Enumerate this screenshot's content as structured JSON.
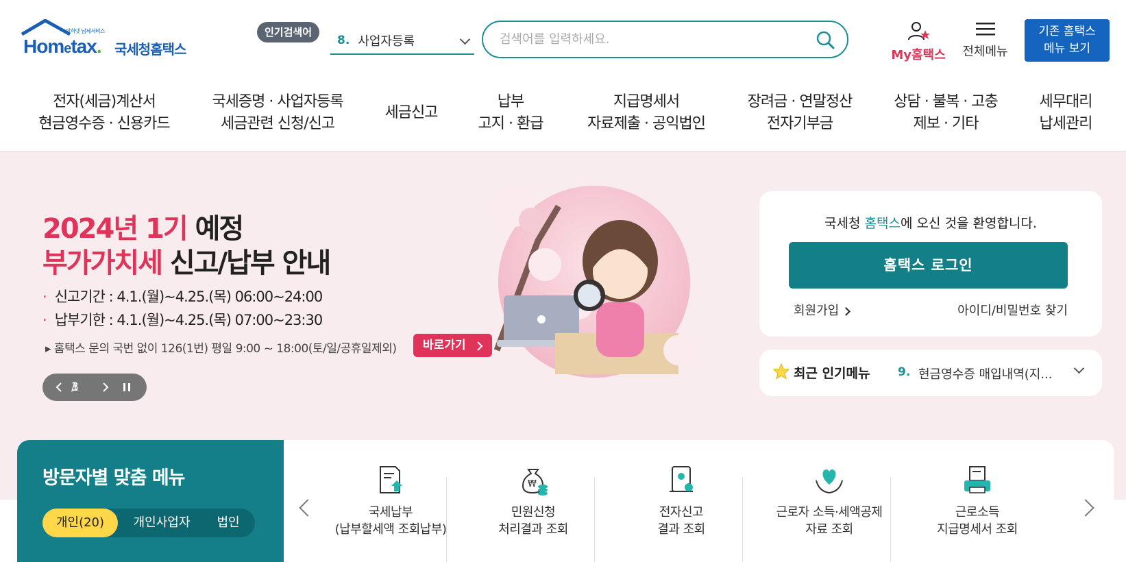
{
  "header": {
    "logo_tagline": "안하넷 납세서비스",
    "logo_brand_prefix": "Hom",
    "logo_brand_e": "e",
    "logo_brand_suffix": "tax",
    "logo_brand_dot": ".",
    "logo_korean": "국세청홈택스",
    "popular_badge": "인기검색어",
    "popular_rank": "8.",
    "popular_term": "사업자등록",
    "search_placeholder": "검색어를 입력하세요.",
    "my_hometax": "My홈택스",
    "all_menu": "전체메뉴",
    "legacy_line1": "기존 홈택스",
    "legacy_line2": "메뉴 보기"
  },
  "nav": [
    {
      "line1": "전자(세금)계산서",
      "line2": "현금영수증 · 신용카드"
    },
    {
      "line1": "국세증명 · 사업자등록",
      "line2": "세금관련 신청/신고"
    },
    {
      "line1": "세금신고",
      "line2": ""
    },
    {
      "line1": "납부",
      "line2": "고지 · 환급"
    },
    {
      "line1": "지급명세서",
      "line2": "자료제출 · 공익법인"
    },
    {
      "line1": "장려금 · 연말정산",
      "line2": "전자기부금"
    },
    {
      "line1": "상담 · 불복 · 고충",
      "line2": "제보 · 기타"
    },
    {
      "line1": "세무대리",
      "line2": "납세관리"
    }
  ],
  "hero": {
    "title1_red": "2024년 1기",
    "title1_black": " 예정",
    "title2_red": "부가가치세",
    "title2_black": " 신고/납부 안내",
    "bullet": "·",
    "line1": "신고기간 : 4.1.(월)~4.25.(목) 06:00~24:00",
    "line2": "납부기한 : 4.1.(월)~4.25.(목) 07:00~23:30",
    "note": "▸ 홈택스 문의 국번 없이 126(1번) 평일 9:00 ~ 18:00(토/일/공휴일제외)",
    "goto": "바로가기",
    "pager_current": "1",
    "pager_sep": "/",
    "pager_total": "3"
  },
  "login": {
    "welcome_pre": "국세청 ",
    "welcome_brand": "홈택스",
    "welcome_post": "에 오신 것을 환영합니다.",
    "login_button": "홈택스 로그인",
    "signup": "회원가입",
    "find": "아이디/비밀번호 찾기"
  },
  "recent": {
    "title": "최근 인기메뉴",
    "rank": "9.",
    "item": "현금영수증 매입내역(지..."
  },
  "visitor": {
    "title": "방문자별 맞춤 메뉴",
    "tabs": [
      "개인(20)",
      "개인사업자",
      "법인"
    ],
    "items": [
      {
        "line1": "국세납부",
        "line2": "(납부할세액 조회납부)",
        "icon": "tax-payment-icon"
      },
      {
        "line1": "민원신청",
        "line2": "처리결과 조회",
        "icon": "money-bag-icon"
      },
      {
        "line1": "전자신고",
        "line2": "결과 조회",
        "icon": "scroll-document-icon"
      },
      {
        "line1": "근로자 소득·세액공제",
        "line2": "자료 조회",
        "icon": "heart-hands-icon"
      },
      {
        "line1": "근로소득",
        "line2": "지급명세서 조회",
        "icon": "printer-document-icon"
      }
    ]
  },
  "colors": {
    "teal": "#147f88",
    "red_accent": "#e0335a",
    "blue_button": "#1565c0",
    "hero_bg": "#f9ecee",
    "yellow_tab": "#ffd84a"
  }
}
